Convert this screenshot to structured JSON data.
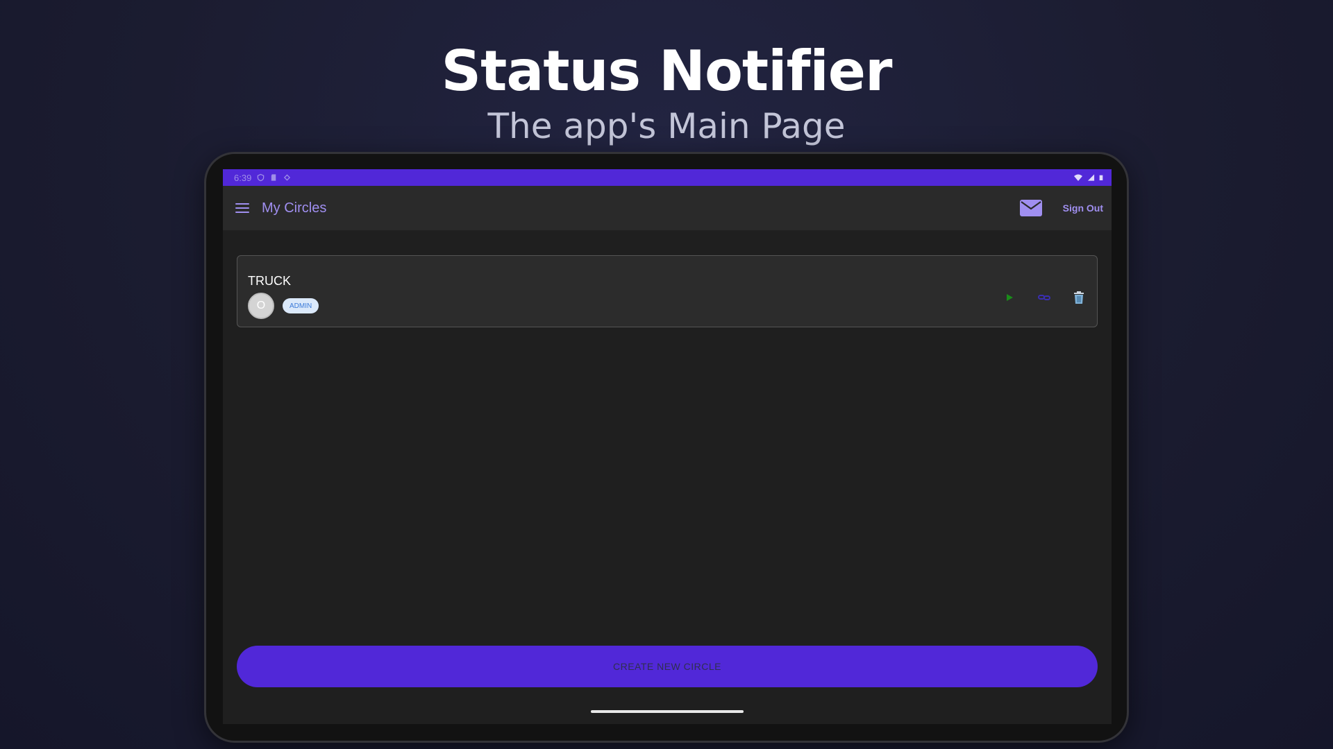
{
  "hero": {
    "title": "Status Notifier",
    "subtitle": "The app's Main Page"
  },
  "status_bar": {
    "time": "6:39",
    "left_icons": [
      "vpn-shield-icon",
      "sd-card-icon",
      "diamond-icon"
    ],
    "right_icons": [
      "wifi-icon",
      "signal-icon",
      "battery-icon"
    ]
  },
  "app_bar": {
    "title": "My Circles",
    "menu_icon": "menu-icon",
    "mail_icon": "mail-icon",
    "sign_out_label": "Sign Out"
  },
  "circles": [
    {
      "name": "TRUCK",
      "avatar_letter": "O",
      "role_badge": "ADMIN",
      "actions": [
        "play-icon",
        "link-icon",
        "trash-icon"
      ]
    }
  ],
  "create_button_label": "CREATE NEW CIRCLE",
  "colors": {
    "accent": "#5128d8",
    "app_text": "#a08ff0",
    "play": "#1a8c1a",
    "link": "#3a2fb0",
    "badge_bg": "#dbe9fa",
    "badge_text": "#3b7ad8"
  }
}
